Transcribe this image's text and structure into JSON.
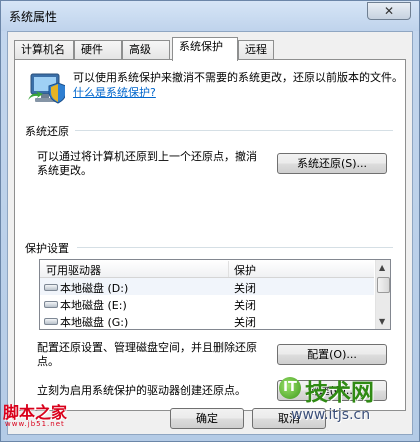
{
  "window": {
    "title": "系统属性",
    "close_glyph": "✕"
  },
  "tabs": [
    {
      "label": "计算机名"
    },
    {
      "label": "硬件"
    },
    {
      "label": "高级"
    },
    {
      "label": "系统保护",
      "active": true
    },
    {
      "label": "远程"
    }
  ],
  "intro": {
    "text": "可以使用系统保护来撤消不需要的系统更改，还原以前版本的文件。",
    "link": "什么是系统保护?"
  },
  "restore": {
    "heading": "系统还原",
    "description": "可以通过将计算机还原到上一个还原点，撤消系统更改。",
    "button": "系统还原(S)..."
  },
  "protection": {
    "heading": "保护设置",
    "columns": {
      "drive": "可用驱动器",
      "status": "保护"
    },
    "drives": [
      {
        "name": "本地磁盘  (D:)",
        "status": "关闭"
      },
      {
        "name": "本地磁盘  (E:)",
        "status": "关闭"
      },
      {
        "name": "本地磁盘  (G:)",
        "status": "关闭"
      }
    ],
    "configure_text": "配置还原设置、管理磁盘空间，并且删除还原点。",
    "configure_button": "配置(O)...",
    "create_text": "立刻为启用系统保护的驱动器创建还原点。",
    "create_button": "创建(C)..."
  },
  "footer": {
    "ok": "确定",
    "cancel": "取消"
  },
  "watermarks": {
    "left_title": "脚本之家",
    "left_url": "www.jb51.net",
    "right_logo": "IT",
    "right_title": "技术网",
    "right_url": "www.itjs.cn"
  },
  "colors": {
    "link": "#0066cc",
    "watermark_red": "#d9001b",
    "watermark_green": "#2f8a13"
  }
}
